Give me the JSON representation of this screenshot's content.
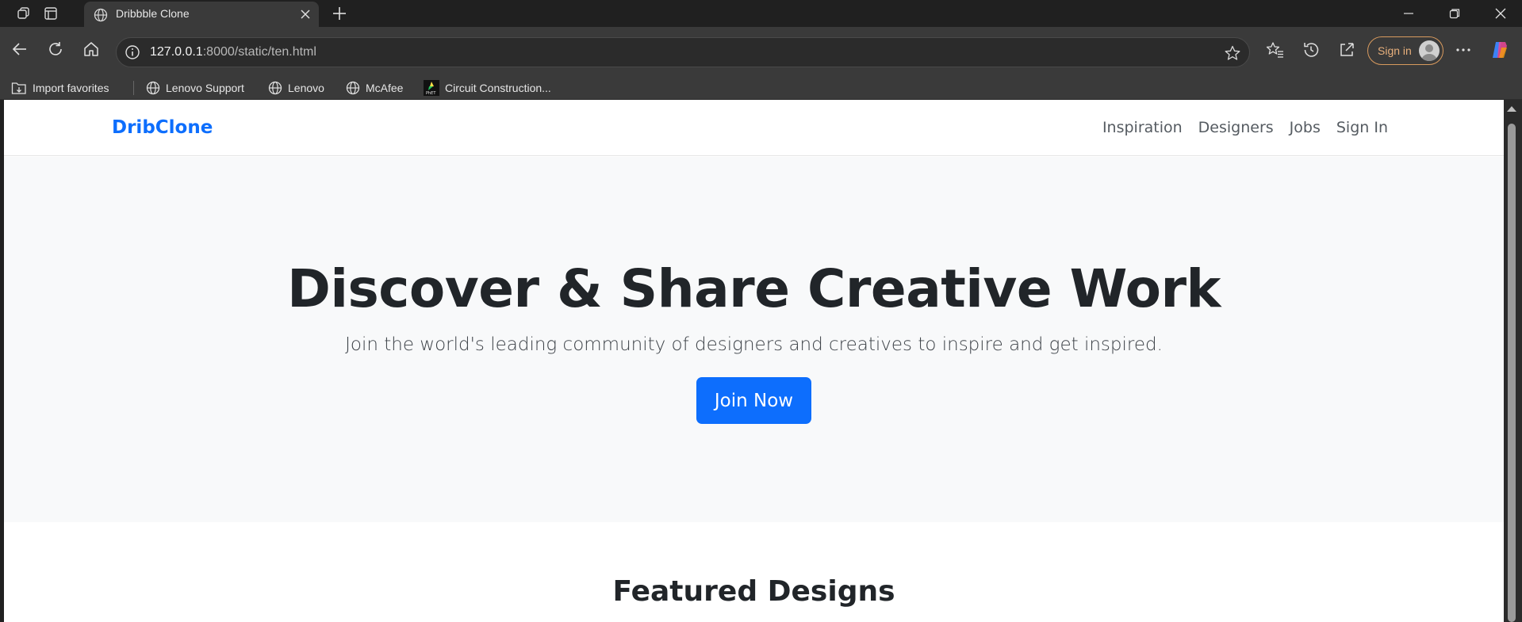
{
  "browser": {
    "tab": {
      "title": "Dribbble Clone"
    },
    "address": {
      "host": "127.0.0.1",
      "rest": ":8000/static/ten.html"
    },
    "signin_label": "Sign in",
    "bookmarks": [
      {
        "label": "Import favorites",
        "icon": "import-favorites-icon"
      },
      {
        "label": "Lenovo Support",
        "icon": "globe-icon"
      },
      {
        "label": "Lenovo",
        "icon": "globe-icon"
      },
      {
        "label": "McAfee",
        "icon": "globe-icon"
      },
      {
        "label": "Circuit Construction...",
        "icon": "phet-icon"
      }
    ]
  },
  "site": {
    "brand": "DribClone",
    "nav": [
      "Inspiration",
      "Designers",
      "Jobs",
      "Sign In"
    ],
    "hero": {
      "title": "Discover & Share Creative Work",
      "subtitle": "Join the world's leading community of designers and creatives to inspire and get inspired.",
      "cta": "Join Now"
    },
    "featured_title": "Featured Designs"
  },
  "colors": {
    "brand": "#0d6efd",
    "hero_bg": "#f8f9fa",
    "browser_chrome": "#3a3a3a",
    "signin_accent": "#d89a5e"
  }
}
